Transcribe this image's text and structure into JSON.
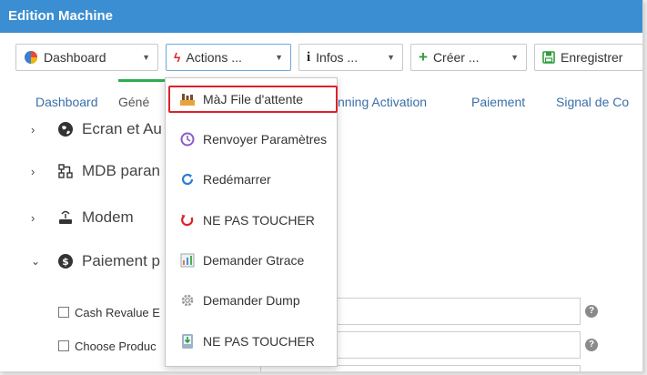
{
  "window": {
    "title": "Edition Machine"
  },
  "toolbar": {
    "dashboard": "Dashboard",
    "actions": "Actions ...",
    "infos": "Infos ...",
    "creer": "Créer ...",
    "enregistrer": "Enregistrer"
  },
  "tabs": {
    "dashboard": "Dashboard",
    "general": "Géné",
    "running_activation": "nning Activation",
    "paiement": "Paiement",
    "signal": "Signal de Co"
  },
  "tree": {
    "ecran": "Ecran et Au",
    "mdb": "MDB paran",
    "modem": "Modem",
    "paiement": "Paiement p"
  },
  "fields": {
    "cash_revalue": "Cash Revalue E",
    "choose_product": "Choose Produc"
  },
  "dropdown": {
    "items": [
      {
        "label": "MàJ File d'attente",
        "icon": "queue-update-icon"
      },
      {
        "label": "Renvoyer Paramètres",
        "icon": "resend-params-icon"
      },
      {
        "label": "Redémarrer",
        "icon": "restart-icon"
      },
      {
        "label": "NE PAS TOUCHER",
        "icon": "power-red-icon"
      },
      {
        "label": "Demander Gtrace",
        "icon": "gtrace-icon"
      },
      {
        "label": "Demander Dump",
        "icon": "gear-dump-icon"
      },
      {
        "label": "NE PAS TOUCHER",
        "icon": "download-device-icon"
      }
    ]
  },
  "colors": {
    "titlebar": "#3b8ed1",
    "tab_active": "#2eae4f",
    "highlight": "#e0202c",
    "link": "#3a6fa8"
  }
}
